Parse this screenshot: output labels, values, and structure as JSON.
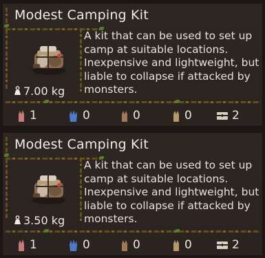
{
  "colors": {
    "background": "#1c1714",
    "panel": "#2e2622",
    "text": "#f1ece3",
    "vine": "#6b5526"
  },
  "items": [
    {
      "name": "Modest Camping Kit",
      "description": "A kit that can be used to set up camp at suitable locations. Inexpensive and lightweight, but liable to collapse if attacked by monsters.",
      "weight": "7.00 kg",
      "icon": "camping-kit-icon",
      "stats": [
        {
          "icon": "strength-hand-icon",
          "value": "1",
          "color": "#c97a7a"
        },
        {
          "icon": "water-hand-icon",
          "value": "0",
          "color": "#4f79c9"
        },
        {
          "icon": "earth-hand-icon",
          "value": "0",
          "color": "#a07a56"
        },
        {
          "icon": "wind-hand-icon",
          "value": "0",
          "color": "#b49a6a"
        },
        {
          "icon": "chest-icon",
          "value": "2",
          "color": "#d8d0c2"
        }
      ]
    },
    {
      "name": "Modest Camping Kit",
      "description": "A kit that can be used to set up camp at suitable locations. Inexpensive and lightweight, but liable to collapse if attacked by monsters.",
      "weight": "3.50 kg",
      "icon": "camping-kit-icon",
      "stats": [
        {
          "icon": "strength-hand-icon",
          "value": "1",
          "color": "#c97a7a"
        },
        {
          "icon": "water-hand-icon",
          "value": "0",
          "color": "#4f79c9"
        },
        {
          "icon": "earth-hand-icon",
          "value": "0",
          "color": "#a07a56"
        },
        {
          "icon": "wind-hand-icon",
          "value": "0",
          "color": "#b49a6a"
        },
        {
          "icon": "chest-icon",
          "value": "2",
          "color": "#d8d0c2"
        }
      ]
    }
  ]
}
